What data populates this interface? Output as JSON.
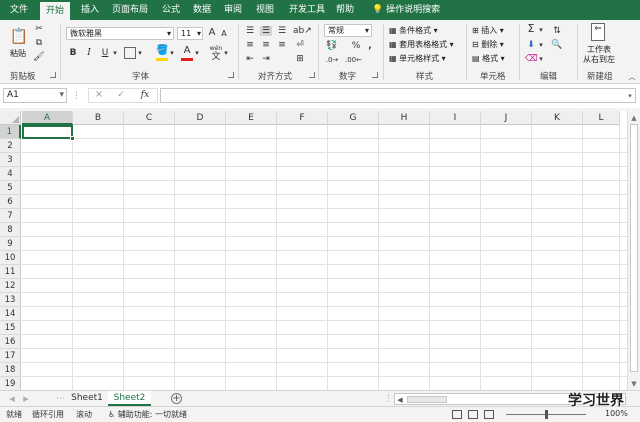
{
  "tabs": [
    {
      "label": "文件",
      "active": false
    },
    {
      "label": "开始",
      "active": true
    },
    {
      "label": "插入",
      "active": false
    },
    {
      "label": "页面布局",
      "active": false
    },
    {
      "label": "公式",
      "active": false
    },
    {
      "label": "数据",
      "active": false
    },
    {
      "label": "审阅",
      "active": false
    },
    {
      "label": "视图",
      "active": false
    },
    {
      "label": "开发工具",
      "active": false
    },
    {
      "label": "帮助",
      "active": false
    }
  ],
  "tell_me": "操作说明搜索",
  "clipboard": {
    "paste": "粘贴",
    "group": "剪贴板"
  },
  "font": {
    "name": "微软雅黑",
    "size": "11",
    "group": "字体",
    "bold": "B",
    "italic": "I",
    "underline": "U",
    "grow": "A",
    "shrink": "A",
    "wen": "wén",
    "color_a": "A"
  },
  "alignment": {
    "group": "对齐方式"
  },
  "number": {
    "format": "常规",
    "percent": "%",
    "comma": ",",
    "group": "数字"
  },
  "styles": {
    "conditional": "条件格式",
    "table": "套用表格格式",
    "cell": "单元格样式",
    "group": "样式"
  },
  "cells": {
    "insert": "插入",
    "delete": "删除",
    "format": "格式",
    "group": "单元格"
  },
  "editing": {
    "sigma": "Σ",
    "group": "编辑"
  },
  "newgroup": {
    "line1": "工作表",
    "line2": "从右到左",
    "group": "新建组"
  },
  "formula_bar": {
    "name_box": "A1",
    "cancel": "×",
    "enter": "✓",
    "fx": "fx",
    "content": ""
  },
  "columns": [
    "A",
    "B",
    "C",
    "D",
    "E",
    "F",
    "G",
    "H",
    "I",
    "J",
    "K",
    "L"
  ],
  "rows": [
    "1",
    "2",
    "3",
    "4",
    "5",
    "6",
    "7",
    "8",
    "9",
    "10",
    "11",
    "12",
    "13",
    "14",
    "15",
    "16",
    "17",
    "18",
    "19"
  ],
  "sheets": [
    {
      "label": "Sheet1",
      "active": false
    },
    {
      "label": "Sheet2",
      "active": true
    }
  ],
  "add_sheet": "+",
  "status": {
    "ready": "就绪",
    "circular": "循环引用",
    "scroll": "滚动",
    "accessibility": "辅助功能: 一切就绪",
    "zoom": "100%"
  },
  "watermark": "学习世界",
  "colors": {
    "brand": "#217346",
    "ribbon": "#f3f3f3",
    "grid": "#e1e1e1",
    "font_color_underline": "#e02020",
    "fill_color_underline": "#ffd400"
  }
}
